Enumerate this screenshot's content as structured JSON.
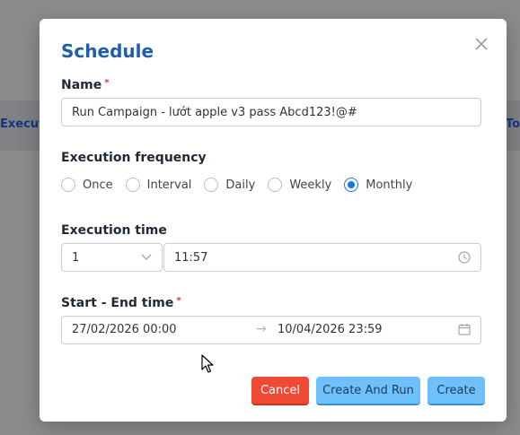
{
  "background": {
    "left_text": "Executio",
    "right_text": "To"
  },
  "dialog": {
    "title": "Schedule",
    "close_icon": "close-icon",
    "name": {
      "label": "Name",
      "required_mark": "*",
      "value": "Run Campaign - lướt apple v3 pass Abcd123!@#"
    },
    "frequency": {
      "label": "Execution frequency",
      "options": [
        {
          "label": "Once",
          "checked": false
        },
        {
          "label": "Interval",
          "checked": false
        },
        {
          "label": "Daily",
          "checked": false
        },
        {
          "label": "Weekly",
          "checked": false
        },
        {
          "label": "Monthly",
          "checked": true
        }
      ]
    },
    "execution_time": {
      "label": "Execution time",
      "day_value": "1",
      "time_value": "11:57"
    },
    "range": {
      "label": "Start - End time",
      "required_mark": "*",
      "start": "27/02/2026 00:00",
      "separator": "→",
      "end": "10/04/2026 23:59"
    },
    "buttons": {
      "cancel": "Cancel",
      "create_and_run": "Create And Run",
      "create": "Create"
    }
  },
  "colors": {
    "title": "#1e5fa8",
    "cancel_bg": "#f04a36",
    "primary_bg": "#6ec1fb",
    "radio_checked": "#1a73e8"
  }
}
